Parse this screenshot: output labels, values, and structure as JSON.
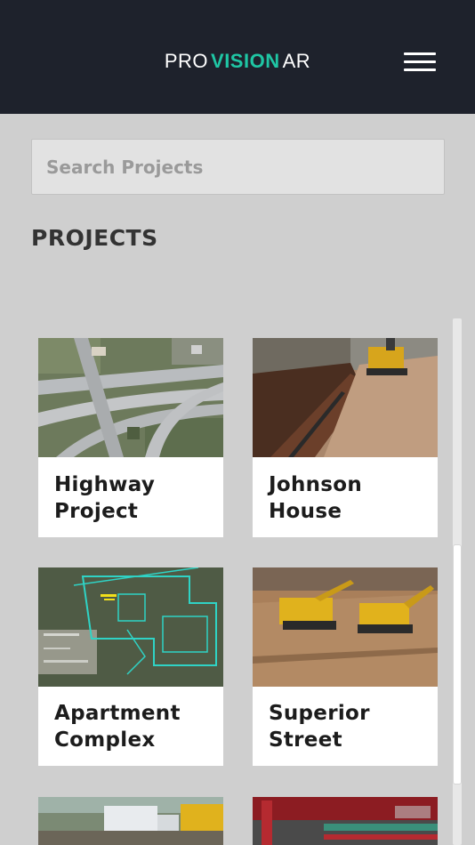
{
  "header": {
    "logo_pro": "PRO",
    "logo_vision": "VISION",
    "logo_ar": "AR",
    "accent": "#1fc6a4",
    "background": "#1e222c",
    "menu_icon": "hamburger-menu-icon"
  },
  "search": {
    "value": "",
    "placeholder": "Search Projects"
  },
  "section": {
    "title": "PROJECTS"
  },
  "projects": [
    {
      "line1": "Highway",
      "line2": "Project",
      "thumbnail": "aerial-highway-interchange"
    },
    {
      "line1": "Johnson",
      "line2": "House",
      "thumbnail": "excavator-trench"
    },
    {
      "line1": "Apartment",
      "line2": "Complex",
      "thumbnail": "aerial-site-plan-overlay"
    },
    {
      "line1": "Superior",
      "line2": "Street",
      "thumbnail": "excavators-dirt-site"
    },
    {
      "line1": "",
      "line2": "",
      "thumbnail": "construction-trucks"
    },
    {
      "line1": "",
      "line2": "",
      "thumbnail": "red-ar-pipes"
    }
  ]
}
